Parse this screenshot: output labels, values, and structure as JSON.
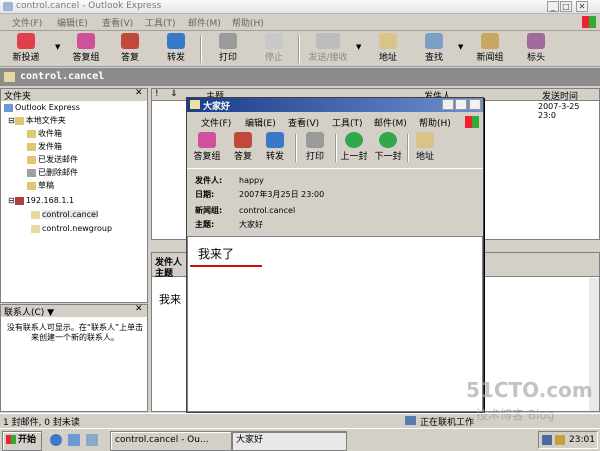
{
  "window": {
    "title": "control.cancel - Outlook Express"
  },
  "menu": [
    "文件(F)",
    "编辑(E)",
    "查看(V)",
    "工具(T)",
    "邮件(M)",
    "帮助(H)"
  ],
  "toolbar": {
    "new_post": "新投递",
    "reply_group": "答复组",
    "reply": "答复",
    "forward": "转发",
    "print": "打印",
    "stop": "停止",
    "send_recv": "发送/接收",
    "addresses": "地址",
    "find": "查找",
    "newsgroups": "新闻组",
    "headers": "标头"
  },
  "folder_bar": {
    "title": "control.cancel"
  },
  "folders": {
    "header": "文件夹",
    "root": "Outlook Express",
    "local": "本地文件夹",
    "items": [
      "收件箱",
      "发件箱",
      "已发送邮件",
      "已删除邮件",
      "草稿"
    ],
    "server": "192.168.1.1",
    "groups": [
      "control.cancel",
      "control.newgroup"
    ]
  },
  "contacts": {
    "header": "联系人(C) ▼",
    "empty_text": "没有联系人可显示。在“联系人”上单击来创建一个新的联系人。"
  },
  "message_list": {
    "col_subject": "主题",
    "col_from": "发件人",
    "col_sent": "发送时间",
    "row_sent": "2007-3-25 23:0"
  },
  "preview": {
    "from_label": "发件人",
    "subject_label": "主题",
    "body": "我来"
  },
  "status": {
    "left": "1 封邮件, 0 封未读",
    "right": "正在联机工作"
  },
  "taskbar": {
    "start": "开始",
    "task1": "control.cancel - Ou...",
    "task2": "大家好",
    "clock": "23:01"
  },
  "msg_window": {
    "title": "大家好",
    "menu": [
      "文件(F)",
      "编辑(E)",
      "查看(V)",
      "工具(T)",
      "邮件(M)",
      "帮助(H)"
    ],
    "toolbar": {
      "reply_group": "答复组",
      "reply": "答复",
      "forward": "转发",
      "print": "打印",
      "prev": "上一封",
      "next": "下一封",
      "addresses": "地址"
    },
    "from_label": "发件人:",
    "from": "happy",
    "date_label": "日期:",
    "date": "2007年3月25日 23:00",
    "group_label": "新闻组:",
    "group": "control.cancel",
    "subject_label": "主题:",
    "subject": "大家好",
    "body": "我来了"
  },
  "watermark": {
    "line1": "51CTO.com",
    "line2": "技术博客  Blog"
  }
}
